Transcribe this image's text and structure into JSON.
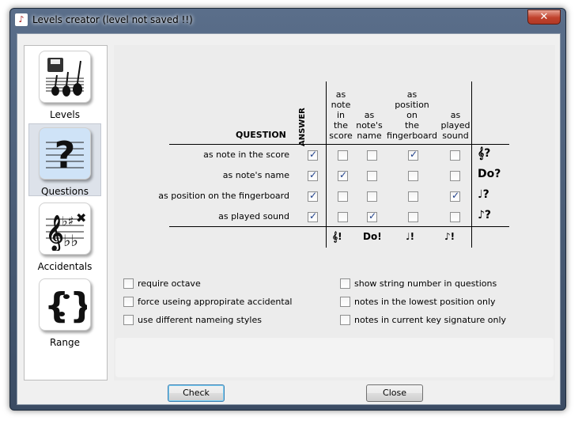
{
  "window": {
    "title": "Levels creator  (level not saved !!)",
    "close_label": "✕"
  },
  "sidebar": {
    "items": [
      {
        "label": "Levels",
        "icon": "guitars-icon"
      },
      {
        "label": "Questions",
        "icon": "question-icon"
      },
      {
        "label": "Accidentals",
        "icon": "accidentals-icon"
      },
      {
        "label": "Range",
        "icon": "range-icon"
      }
    ]
  },
  "table": {
    "question_header": "QUESTION",
    "answer_header": "ANSWER",
    "answer_columns": [
      "as\nnote\nin\nthe\nscore",
      "as\nnote's\nname",
      "as\nposition\non\nthe\nfingerboard",
      "as\nplayed\nsound"
    ],
    "rows": [
      {
        "label": "as note in the score",
        "answer": true,
        "cells": [
          false,
          false,
          true,
          false
        ],
        "icon": "𝄞?"
      },
      {
        "label": "as note's name",
        "answer": true,
        "cells": [
          true,
          false,
          false,
          false
        ],
        "icon": "Do?"
      },
      {
        "label": "as position on the fingerboard",
        "answer": true,
        "cells": [
          false,
          false,
          false,
          true
        ],
        "icon": "♩?"
      },
      {
        "label": "as played sound",
        "answer": true,
        "cells": [
          false,
          true,
          false,
          false
        ],
        "icon": "♪?"
      }
    ],
    "answer_icons": [
      "𝄞!",
      "Do!",
      "♩!",
      "♪!"
    ]
  },
  "options": {
    "left": [
      {
        "label": "require octave",
        "checked": false
      },
      {
        "label": "force useing appropirate accidental",
        "checked": false
      },
      {
        "label": "use different nameing styles",
        "checked": false
      }
    ],
    "right": [
      {
        "label": "show string number in questions",
        "checked": false
      },
      {
        "label": "notes in the lowest position only",
        "checked": false
      },
      {
        "label": "notes in current key signature only",
        "checked": false
      }
    ]
  },
  "buttons": {
    "check": "Check",
    "close": "Close"
  }
}
